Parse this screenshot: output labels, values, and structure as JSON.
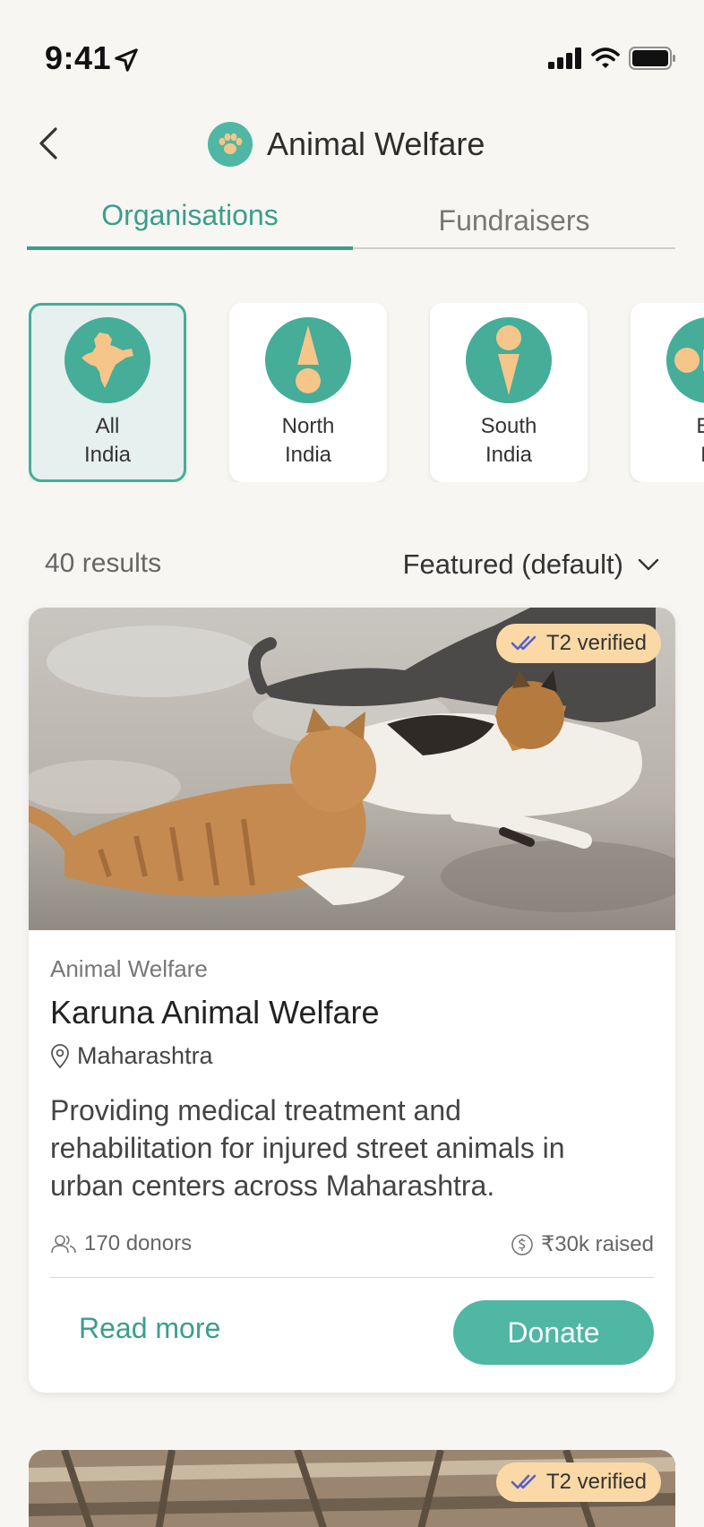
{
  "status": {
    "time": "9:41"
  },
  "header": {
    "title": "Animal Welfare"
  },
  "tabs": [
    {
      "label": "Organisations",
      "active": true
    },
    {
      "label": "Fundraisers",
      "active": false
    }
  ],
  "regions": [
    {
      "label": "All\nIndia",
      "active": true
    },
    {
      "label": "North\nIndia",
      "active": false
    },
    {
      "label": "South\nIndia",
      "active": false
    },
    {
      "label": "Ea\nIn",
      "active": false
    }
  ],
  "results": {
    "count": "40 results",
    "sort": "Featured (default)"
  },
  "card": {
    "badge": "T2 verified",
    "category": "Animal Welfare",
    "title": "Karuna Animal Welfare",
    "location": "Maharashtra",
    "description": "Providing medical treatment and rehabilitation for injured street animals in urban centers across Maharashtra.",
    "donors": "170 donors",
    "raised": "₹30k raised",
    "read_more": "Read more",
    "donate": "Donate"
  },
  "card2": {
    "badge": "T2 verified"
  },
  "colors": {
    "accent": "#4fb7a3",
    "accent_dark": "#3a9e8c",
    "badge": "#fbd9a6",
    "icon_orange": "#f6c589"
  }
}
